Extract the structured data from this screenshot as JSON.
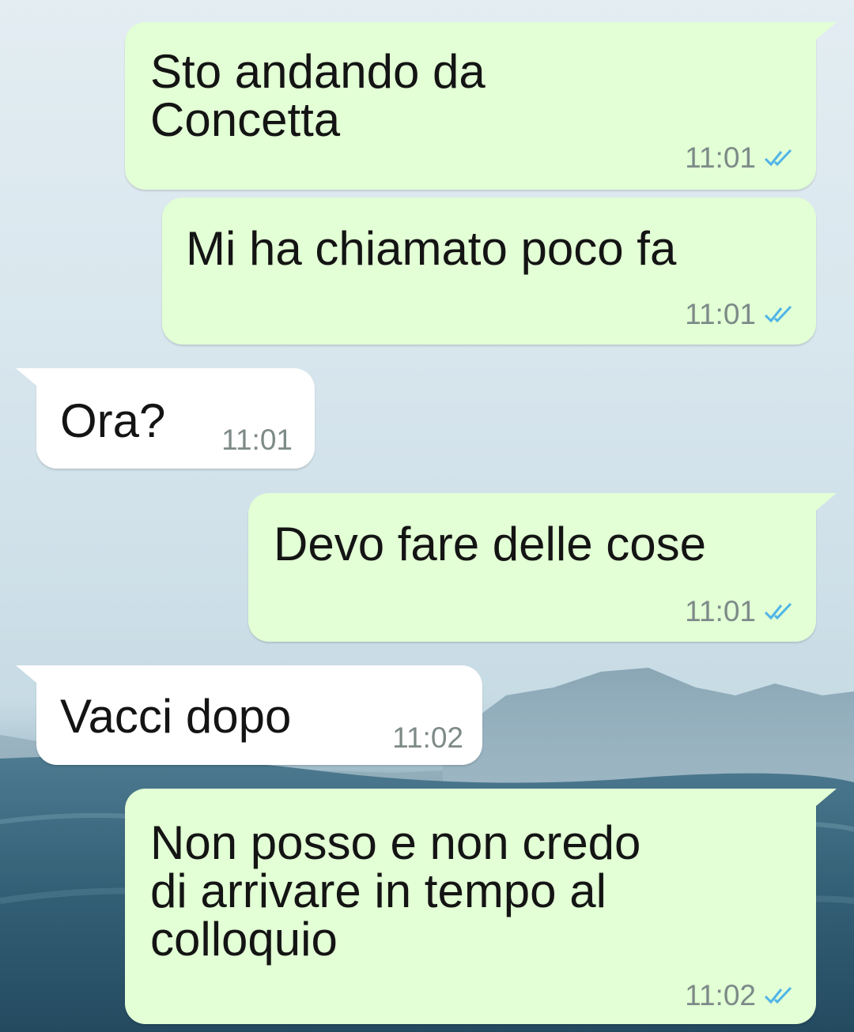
{
  "messages": [
    {
      "text": "Sto andando da\nConcetta",
      "time": "11:01",
      "direction": "outgoing",
      "status_icon": "double-check-icon"
    },
    {
      "text": "Mi ha chiamato poco fa",
      "time": "11:01",
      "direction": "outgoing",
      "status_icon": "double-check-icon"
    },
    {
      "text": "Ora?",
      "time": "11:01",
      "direction": "incoming"
    },
    {
      "text": "Devo fare delle cose",
      "time": "11:01",
      "direction": "outgoing",
      "status_icon": "double-check-icon"
    },
    {
      "text": "Vacci dopo",
      "time": "11:02",
      "direction": "incoming"
    },
    {
      "text": "Non posso e non credo\ndi arrivare in tempo al\ncolloquio",
      "time": "11:02",
      "direction": "outgoing",
      "status_icon": "double-check-icon"
    }
  ],
  "colors": {
    "outgoing_bubble": "#e2ffd5",
    "incoming_bubble": "#ffffff",
    "read_ticks": "#4fb4e8",
    "timestamp": "#7d8a88"
  }
}
